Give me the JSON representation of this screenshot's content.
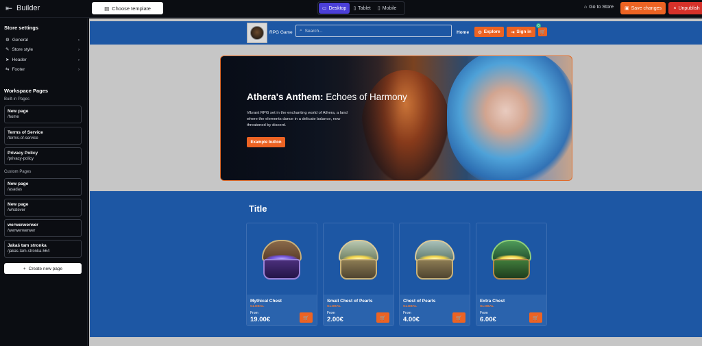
{
  "topbar": {
    "back_icon": "arrow-left-icon",
    "title": "Builder",
    "choose_template": "Choose template",
    "devices": [
      "Desktop",
      "Tablet",
      "Mobile"
    ],
    "active_device": "Desktop",
    "go_to_store": "Go to Store",
    "save_changes": "Save changes",
    "unpublish": "Unpublish",
    "accent": "#ec6323",
    "danger": "#d6312a",
    "device_active_color": "#4b3fd8"
  },
  "sidebar": {
    "store_settings_title": "Store settings",
    "settings": [
      {
        "label": "General",
        "icon": "gear-icon"
      },
      {
        "label": "Store style",
        "icon": "brush-icon"
      },
      {
        "label": "Header",
        "icon": "send-icon"
      },
      {
        "label": "Footer",
        "icon": "swap-icon"
      }
    ],
    "workspace_title": "Workspace Pages",
    "builtin_label": "Built-in Pages",
    "builtin_pages": [
      {
        "name": "New page",
        "path": "/home"
      },
      {
        "name": "Terms of Service",
        "path": "/terms-of-service"
      },
      {
        "name": "Privacy Policy",
        "path": "/privacy-policy"
      }
    ],
    "custom_label": "Custom Pages",
    "custom_pages": [
      {
        "name": "New page",
        "path": "/asadas"
      },
      {
        "name": "New page",
        "path": "/whatever"
      },
      {
        "name": "werwerwerwer",
        "path": "/werwerwerwer"
      },
      {
        "name": "Jakaś tam stronka",
        "path": "/jakas-tam-stronka-564"
      }
    ],
    "create_page": "Create new page"
  },
  "store": {
    "name": "RPG Game",
    "search_placeholder": "Search...",
    "home": "Home",
    "explore": "Explore",
    "sign_in": "Sign in",
    "cart_count": "0",
    "header_color": "#1d57a4"
  },
  "hero": {
    "title_bold": "Athera's Anthem:",
    "title_rest": " Echoes of Harmony",
    "description": "Vibrant RPG set in the enchanting world of Athera, a land where the elements dance in a delicate balance, now threatened by discord.",
    "button": "Example button"
  },
  "products": {
    "title": "Title",
    "items": [
      {
        "name": "Mythical Chest",
        "tag": "GLOBAL",
        "from": "From",
        "price": "19.00€",
        "icon": "mythical-chest-image"
      },
      {
        "name": "Small Chest of Pearls",
        "tag": "GLOBAL",
        "from": "From",
        "price": "2.00€",
        "icon": "pearl-chest-image"
      },
      {
        "name": "Chest of Pearls",
        "tag": "GLOBAL",
        "from": "From",
        "price": "4.00€",
        "icon": "pearl-chest-image"
      },
      {
        "name": "Extra Chest",
        "tag": "GLOBAL",
        "from": "From",
        "price": "6.00€",
        "icon": "extra-chest-image"
      }
    ]
  }
}
